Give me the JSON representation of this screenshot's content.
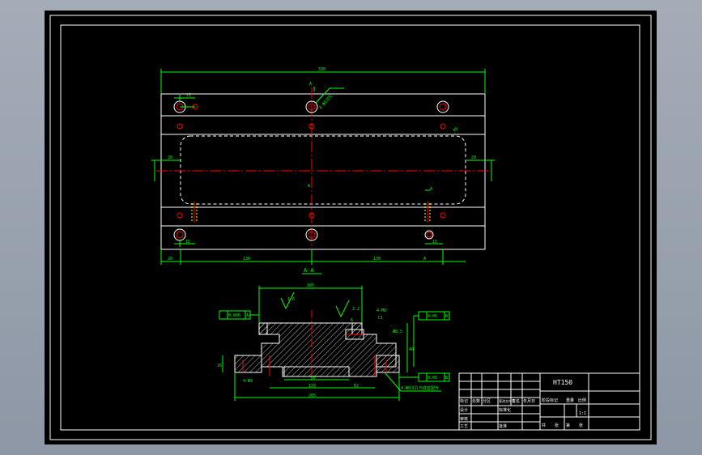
{
  "colors": {
    "sheet": "#000000",
    "outline": "#ffffff",
    "dimension": "#00ff00",
    "centerline": "#ff0000",
    "hidden": "#ffff00",
    "background": "#a4acb8"
  },
  "plan": {
    "overall_width": "330",
    "dim_left_offset": "20",
    "dim_span_mid": "130",
    "dim_span_right": "130",
    "dim_right_offset": "20",
    "edge_left": "20",
    "edge_right": "20",
    "hole_offset_a": "15",
    "hole_offset_b": "15",
    "hole_offset_c": "15",
    "section_mark_top": "A",
    "section_mark_mid": "A",
    "section_mark_right": "A",
    "section_mark_bottom": "A",
    "hole_callout": "4-Φ6沉孔",
    "radius_callout": "R5"
  },
  "section": {
    "title": "A-A",
    "top_width": "185",
    "inner_width": "125",
    "mid_width": "78",
    "bottom_width": "205",
    "flatness_frame": "0.006",
    "flatness_ref": "A",
    "parallel_frame": "0.05",
    "parallel_ref": "B",
    "parallel_frame_low": "0.05",
    "parallel_ref_low": "B",
    "roughness_1": "1.6",
    "roughness_2": "3.2",
    "thread_note": "4-M8",
    "chamfer": "C1",
    "height_left": "16",
    "height_right": "40",
    "depth_note": "6",
    "dim_inner": "Φ8.5",
    "leader_note": "4-Φ8沉孔与底座配作",
    "bottom_left_label": "4-Φ9",
    "radius": "R2"
  },
  "title_block": {
    "material": "HT150",
    "rows_left": [
      "标记",
      "处数",
      "分区",
      "更改文件号",
      "签名",
      "年月日"
    ],
    "design": "设计",
    "standardization": "标准化",
    "review": "审核",
    "process": "工艺",
    "approve": "批准",
    "stage_mark": "阶段标记",
    "weight": "重量",
    "scale": "比例",
    "scale_value": "1:1",
    "sheet_total": "共",
    "sheet_label": "张",
    "sheet_no": "第",
    "sheet_label2": "张"
  }
}
